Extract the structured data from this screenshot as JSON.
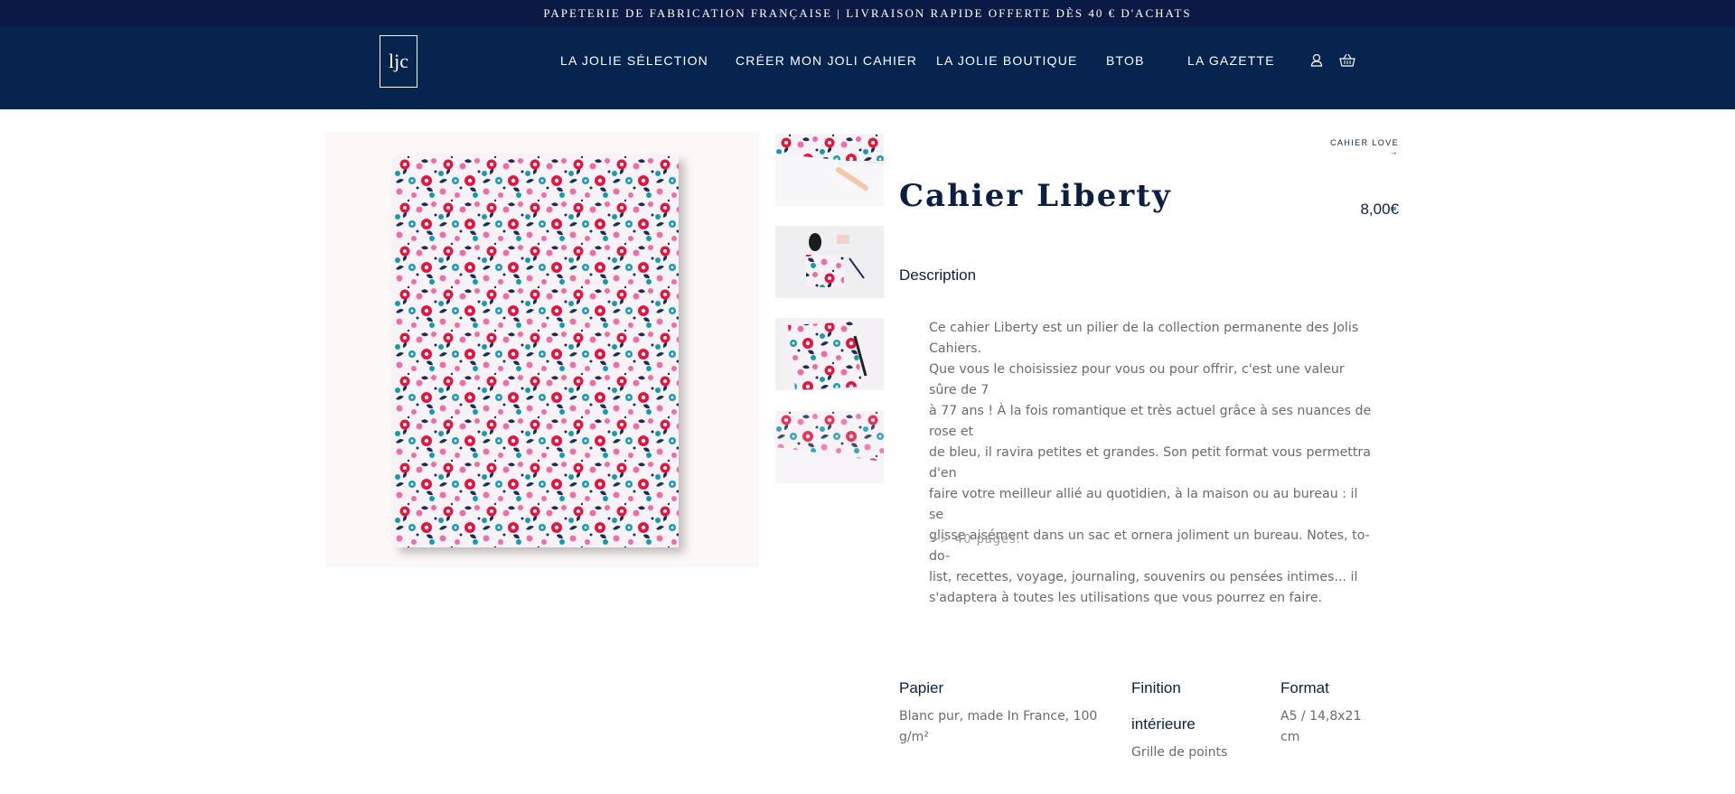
{
  "topbar": {
    "text": "PAPETERIE DE FABRICATION FRANÇAISE | LIVRAISON RAPIDE OFFERTE DÈS 40 € D'ACHATS"
  },
  "header": {
    "logo_text": "ljc",
    "nav": [
      "LA JOLIE SÉLECTION",
      "CRÉER MON JOLI CAHIER",
      "LA JOLIE BOUTIQUE",
      "BTOB",
      "LA GAZETTE"
    ],
    "icons": [
      "user-icon",
      "basket-icon"
    ]
  },
  "product": {
    "breadcrumb": "CAHIER LOVE →",
    "title": "Cahier Liberty",
    "price": "8,00€",
    "description_heading": "Description",
    "description_lines": [
      "Ce cahier Liberty est un pilier de la collection permanente des Jolis Cahiers.",
      "Que vous le choisissiez pour vous ou pour offrir, c'est une valeur sûre de 7",
      "à 77 ans ! À la fois romantique et très actuel grâce à ses nuances de rose et",
      "de bleu, il ravira petites et grandes. Son petit format vous permettra d'en",
      "faire votre meilleur allié au quotidien, à la maison ou au bureau : il se",
      "glisse aisément dans un sac et ornera joliment un bureau. Notes, to-do-",
      "list, recettes, voyage, journaling, souvenirs ou pensées intimes... il",
      "s'adaptera à toutes les utilisations que vous pourrez en faire."
    ],
    "pages_note": ">> 40 pages."
  },
  "specs": {
    "papier": {
      "label": "Papier",
      "value_lines": [
        "Blanc pur, made In France, 100",
        "g/m²"
      ]
    },
    "finition": {
      "label_lines": [
        "Finition",
        "intérieure"
      ],
      "value": "Grille de points"
    },
    "format": {
      "label": "Format",
      "value_lines": [
        "A5 / 14,8x21",
        "cm"
      ]
    }
  },
  "colors": {
    "topbar_bg": "#0a1a45",
    "header_bg": "#06244d",
    "navy_text": "#0b1f45",
    "pattern_red": "#e0173f",
    "pattern_pink": "#ea6fa6",
    "pattern_teal": "#1798b8",
    "pattern_navy": "#1c2e5c"
  }
}
